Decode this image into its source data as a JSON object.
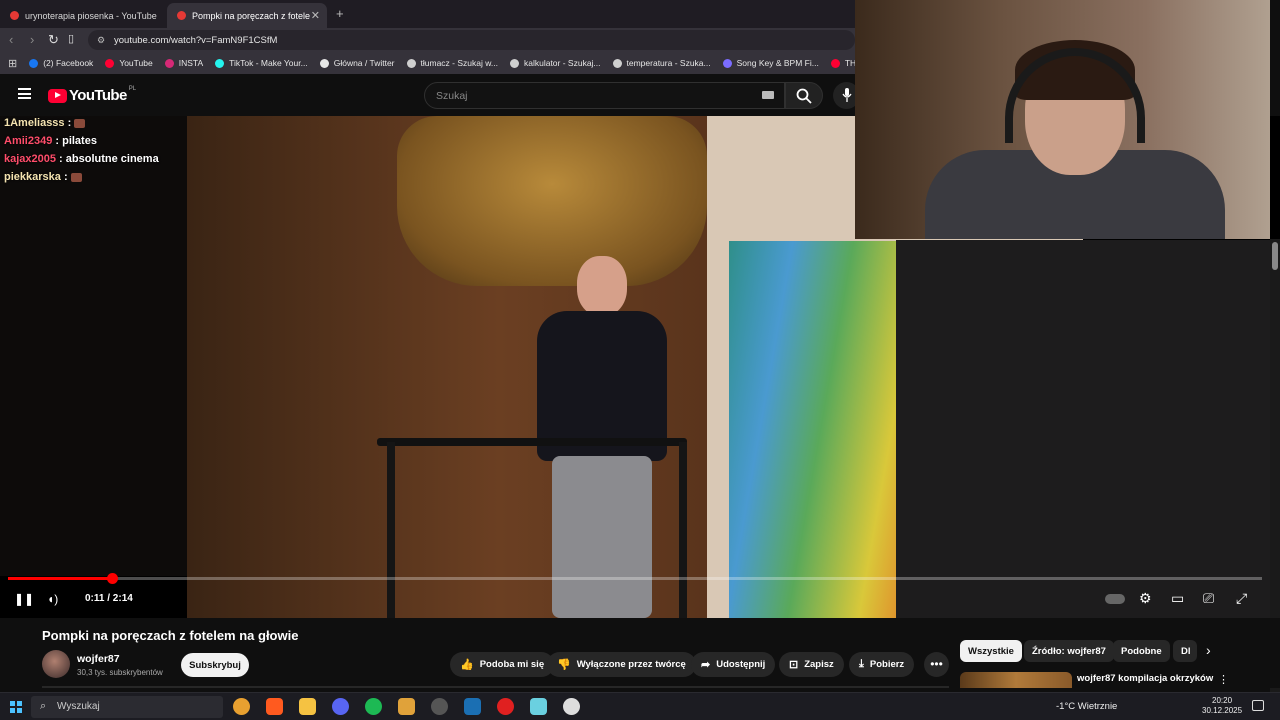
{
  "browser": {
    "tabs": [
      {
        "label": "urynoterapia piosenka - YouTube",
        "active": false
      },
      {
        "label": "Pompki na poręczach z fotele",
        "active": true
      }
    ],
    "new_tab": "+",
    "url": "youtube.com/watch?v=FamN9F1CSfM",
    "bookmarks": [
      {
        "label": "(2) Facebook",
        "color": "#1877f2"
      },
      {
        "label": "YouTube",
        "color": "#ff0033"
      },
      {
        "label": "INSTA",
        "color": "#d62976"
      },
      {
        "label": "TikTok - Make Your...",
        "color": "#25f4ee"
      },
      {
        "label": "Główna / Twitter",
        "color": "#e7e7e7"
      },
      {
        "label": "tłumacz - Szukaj w...",
        "color": "#cfcfcf"
      },
      {
        "label": "kalkulator - Szukaj...",
        "color": "#cfcfcf"
      },
      {
        "label": "temperatura - Szuka...",
        "color": "#cfcfcf"
      },
      {
        "label": "Song Key & BPM Fi...",
        "color": "#7b6cff"
      },
      {
        "label": "THIS is W",
        "color": "#ff0033"
      }
    ]
  },
  "youtube": {
    "logo_text": "YouTube",
    "region": "PL",
    "search_placeholder": "Szukaj"
  },
  "chat": [
    {
      "user": "1Ameliasss",
      "user_color": "#f4e3b0",
      "message": "",
      "emote": true
    },
    {
      "user": "Amii2349",
      "user_color": "#ff4d6a",
      "message": "pilates",
      "emote": false
    },
    {
      "user": "kajax2005",
      "user_color": "#ff4d6a",
      "message": "absolutne cinema",
      "emote": false
    },
    {
      "user": "piekkarska",
      "user_color": "#f4e3b0",
      "message": "",
      "emote": true
    }
  ],
  "player": {
    "time": "0:11 / 2:14",
    "progress_fraction": 0.083,
    "controls": {
      "play_pause": "❚❚",
      "volume": "◖)",
      "settings_badge": "HD"
    }
  },
  "video": {
    "title": "Pompki na poręczach z fotelem na głowie",
    "channel": "wojfer87",
    "subscribers": "30,3 tys. subskrybentów",
    "subscribe_label": "Subskrybuj",
    "actions": [
      {
        "label": "Podoba mi się",
        "icon": "👍"
      },
      {
        "label": "Wyłączone przez twórcę",
        "icon": "👎"
      },
      {
        "label": "Udostępnij",
        "icon": "➦"
      },
      {
        "label": "Zapisz",
        "icon": "🔖"
      },
      {
        "label": "Pobierz",
        "icon": "⤓"
      }
    ],
    "more_label": "•••"
  },
  "filter_chips": [
    "Wszystkie",
    "Źródło: wojfer87",
    "Podobne",
    "Dl"
  ],
  "recommendation": {
    "title": "wojfer87 kompilacja okrzyków"
  },
  "taskbar": {
    "search_placeholder": "Wyszukaj",
    "weather": "-1°C  Wietrznie",
    "time": "20:20",
    "date": "30.12.2025",
    "apps": [
      "#e8a030",
      "#ff5a1f",
      "#f5c242",
      "#5865f2",
      "#1db954",
      "#e0a23a",
      "#555",
      "#1b6fb3",
      "#e02020",
      "#6ad0e0",
      "#ddd"
    ]
  }
}
